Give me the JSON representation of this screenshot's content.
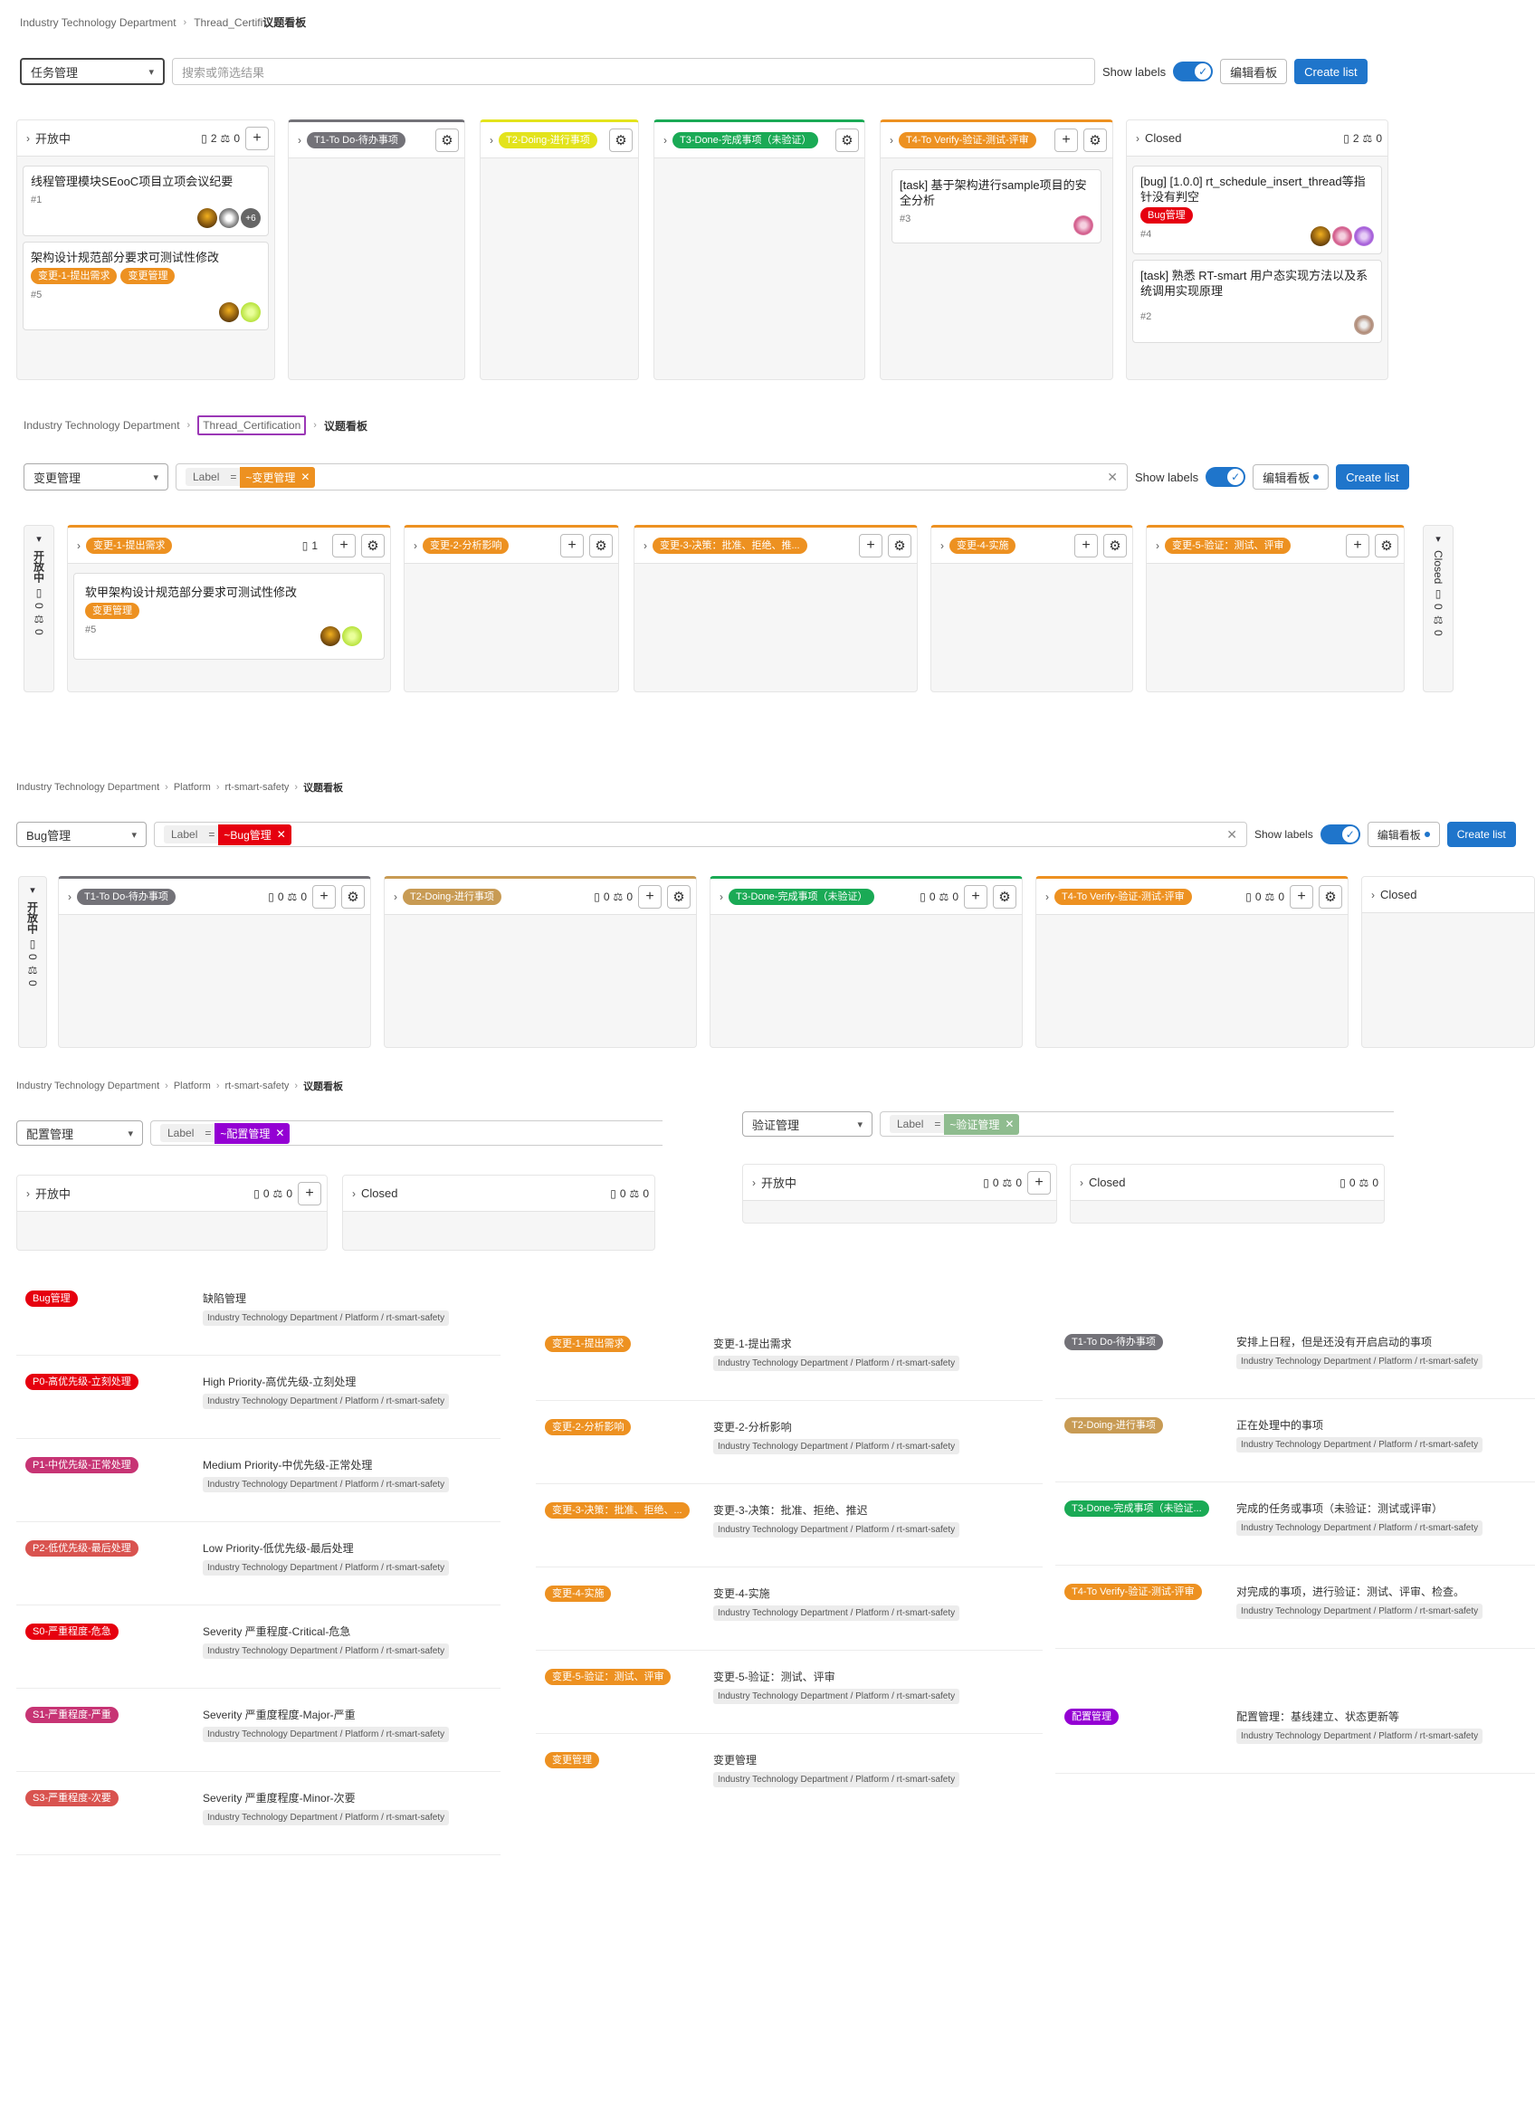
{
  "panel1": {
    "breadcrumb": [
      "Industry Technology Department",
      "Thread_Certifi",
      "议题看板"
    ],
    "select": "任务管理",
    "search_placeholder": "搜索或筛选结果",
    "show_labels": "Show labels",
    "edit_board": "编辑看板",
    "create_list": "Create list",
    "columns": {
      "open": {
        "title": "开放中",
        "issues": "2",
        "weight": "0"
      },
      "t1": {
        "label": "T1-To Do-待办事项"
      },
      "t2": {
        "label": "T2-Doing-进行事项"
      },
      "t3": {
        "label": "T3-Done-完成事项（未验证）"
      },
      "t4": {
        "label": "T4-To Verify-验证-测试-评审"
      },
      "closed": {
        "title": "Closed",
        "issues": "2",
        "weight": "0"
      }
    },
    "cards": {
      "c1": {
        "title": "线程管理模块SEooC项目立项会议纪要",
        "num": "#1",
        "more": "+6"
      },
      "c2": {
        "title": "架构设计规范部分要求可测试性修改",
        "tags": [
          "变更-1-提出需求",
          "变更管理"
        ],
        "num": "#5"
      },
      "c3": {
        "title": "[task] 基于架构进行sample项目的安全分析",
        "num": "#3"
      },
      "c4": {
        "title": "[bug] [1.0.0] rt_schedule_insert_thread等指针没有判空",
        "tag": "Bug管理",
        "num": "#4"
      },
      "c5": {
        "title": "[task] 熟悉 RT-smart 用户态实现方法以及系统调用实现原理",
        "num": "#2"
      }
    }
  },
  "panel2": {
    "breadcrumb": [
      "Industry Technology Department",
      "Thread_Certification",
      "议题看板"
    ],
    "select": "变更管理",
    "token": {
      "key": "Label",
      "op": "=",
      "value": "~变更管理"
    },
    "show_labels": "Show labels",
    "edit_board": "编辑看板",
    "create_list": "Create list",
    "open_vertical": {
      "title": "开放中",
      "issues": "0",
      "weight": "0"
    },
    "closed_vertical": {
      "title": "Closed",
      "issues": "0",
      "weight": "0"
    },
    "columns": {
      "b1": {
        "label": "变更-1-提出需求",
        "count": "1"
      },
      "b2": {
        "label": "变更-2-分析影响"
      },
      "b3": {
        "label": "变更-3-决策：批准、拒绝、推..."
      },
      "b4": {
        "label": "变更-4-实施"
      },
      "b5": {
        "label": "变更-5-验证：测试、评审"
      }
    },
    "card": {
      "title": "软甲架构设计规范部分要求可测试性修改",
      "tag": "变更管理",
      "num": "#5"
    }
  },
  "panel3": {
    "breadcrumb": [
      "Industry Technology Department",
      "Platform",
      "rt-smart-safety",
      "议题看板"
    ],
    "select": "Bug管理",
    "token": {
      "key": "Label",
      "op": "=",
      "value": "~Bug管理"
    },
    "show_labels": "Show labels",
    "edit_board": "编辑看板",
    "create_list": "Create list",
    "open_vertical": {
      "title": "开放中",
      "issues": "0",
      "weight": "0"
    },
    "columns": {
      "t1": {
        "label": "T1-To Do-待办事项",
        "issues": "0",
        "weight": "0"
      },
      "t2": {
        "label": "T2-Doing-进行事项",
        "issues": "0",
        "weight": "0"
      },
      "t3": {
        "label": "T3-Done-完成事项（未验证）",
        "issues": "0",
        "weight": "0"
      },
      "t4": {
        "label": "T4-To Verify-验证-测试-评审",
        "issues": "0",
        "weight": "0"
      },
      "closed": {
        "title": "Closed"
      }
    }
  },
  "panel4": {
    "breadcrumb": [
      "Industry Technology Department",
      "Platform",
      "rt-smart-safety",
      "议题看板"
    ],
    "select": "配置管理",
    "token": {
      "key": "Label",
      "op": "=",
      "value": "~配置管理"
    },
    "open": {
      "title": "开放中",
      "issues": "0",
      "weight": "0"
    },
    "closed": {
      "title": "Closed",
      "issues": "0",
      "weight": "0"
    }
  },
  "panel5": {
    "select": "验证管理",
    "token": {
      "key": "Label",
      "op": "=",
      "value": "~验证管理"
    },
    "open": {
      "title": "开放中",
      "issues": "0",
      "weight": "0"
    },
    "closed": {
      "title": "Closed",
      "issues": "0",
      "weight": "0"
    }
  },
  "labels": {
    "scope": "Industry Technology Department / Platform / rt-smart-safety",
    "col1": [
      {
        "name": "Bug管理",
        "desc": "缺陷管理",
        "color": "#e6000f"
      },
      {
        "name": "P0-高优先级-立刻处理",
        "desc": "High Priority-高优先级-立刻处理",
        "color": "#e6000f"
      },
      {
        "name": "P1-中优先级-正常处理",
        "desc": "Medium Priority-中优先级-正常处理",
        "color": "#c73474"
      },
      {
        "name": "P2-低优先级-最后处理",
        "desc": "Low Priority-低优先级-最后处理",
        "color": "#d9534f"
      },
      {
        "name": "S0-严重程度-危急",
        "desc": "Severity 严重程度-Critical-危急",
        "color": "#e6000f"
      },
      {
        "name": "S1-严重程度-严重",
        "desc": "Severity 严重度程度-Major-严重",
        "color": "#c73474"
      },
      {
        "name": "S3-严重程度-次要",
        "desc": "Severity 严重度程度-Minor-次要",
        "color": "#d9534f"
      }
    ],
    "col2": [
      {
        "name": "变更-1-提出需求",
        "desc": "变更-1-提出需求",
        "color": "#ed9121"
      },
      {
        "name": "变更-2-分析影响",
        "desc": "变更-2-分析影响",
        "color": "#ed9121"
      },
      {
        "name": "变更-3-决策：批准、拒绝、...",
        "desc": "变更-3-决策：批准、拒绝、推迟",
        "color": "#ed9121"
      },
      {
        "name": "变更-4-实施",
        "desc": "变更-4-实施",
        "color": "#ed9121"
      },
      {
        "name": "变更-5-验证：测试、评审",
        "desc": "变更-5-验证：测试、评审",
        "color": "#ed9121"
      },
      {
        "name": "变更管理",
        "desc": "变更管理",
        "color": "#ed9121"
      }
    ],
    "col3": [
      {
        "name": "T1-To Do-待办事项",
        "desc": "安排上日程，但是还没有开启启动的事项",
        "color": "#737278"
      },
      {
        "name": "T2-Doing-进行事项",
        "desc": "正在处理中的事项",
        "color": "#c89b54"
      },
      {
        "name": "T3-Done-完成事项（未验证...",
        "desc": "完成的任务或事项（未验证：测试或评审）",
        "color": "#1aaa55"
      },
      {
        "name": "T4-To Verify-验证-测试-评审",
        "desc": "对完成的事项，进行验证：测试、评审、检查。",
        "color": "#ed9121"
      },
      {
        "name": "配置管理",
        "desc": "配置管理：基线建立、状态更新等",
        "color": "#9400d3"
      }
    ]
  },
  "colors": {
    "accent": "#1f75cb",
    "orange": "#ed9121",
    "red": "#e6000f",
    "green": "#1aaa55",
    "yellow": "#e3e31c",
    "gray": "#737278",
    "purple": "#9400d3",
    "sage": "#8fbc8f",
    "tan": "#c89b54"
  }
}
